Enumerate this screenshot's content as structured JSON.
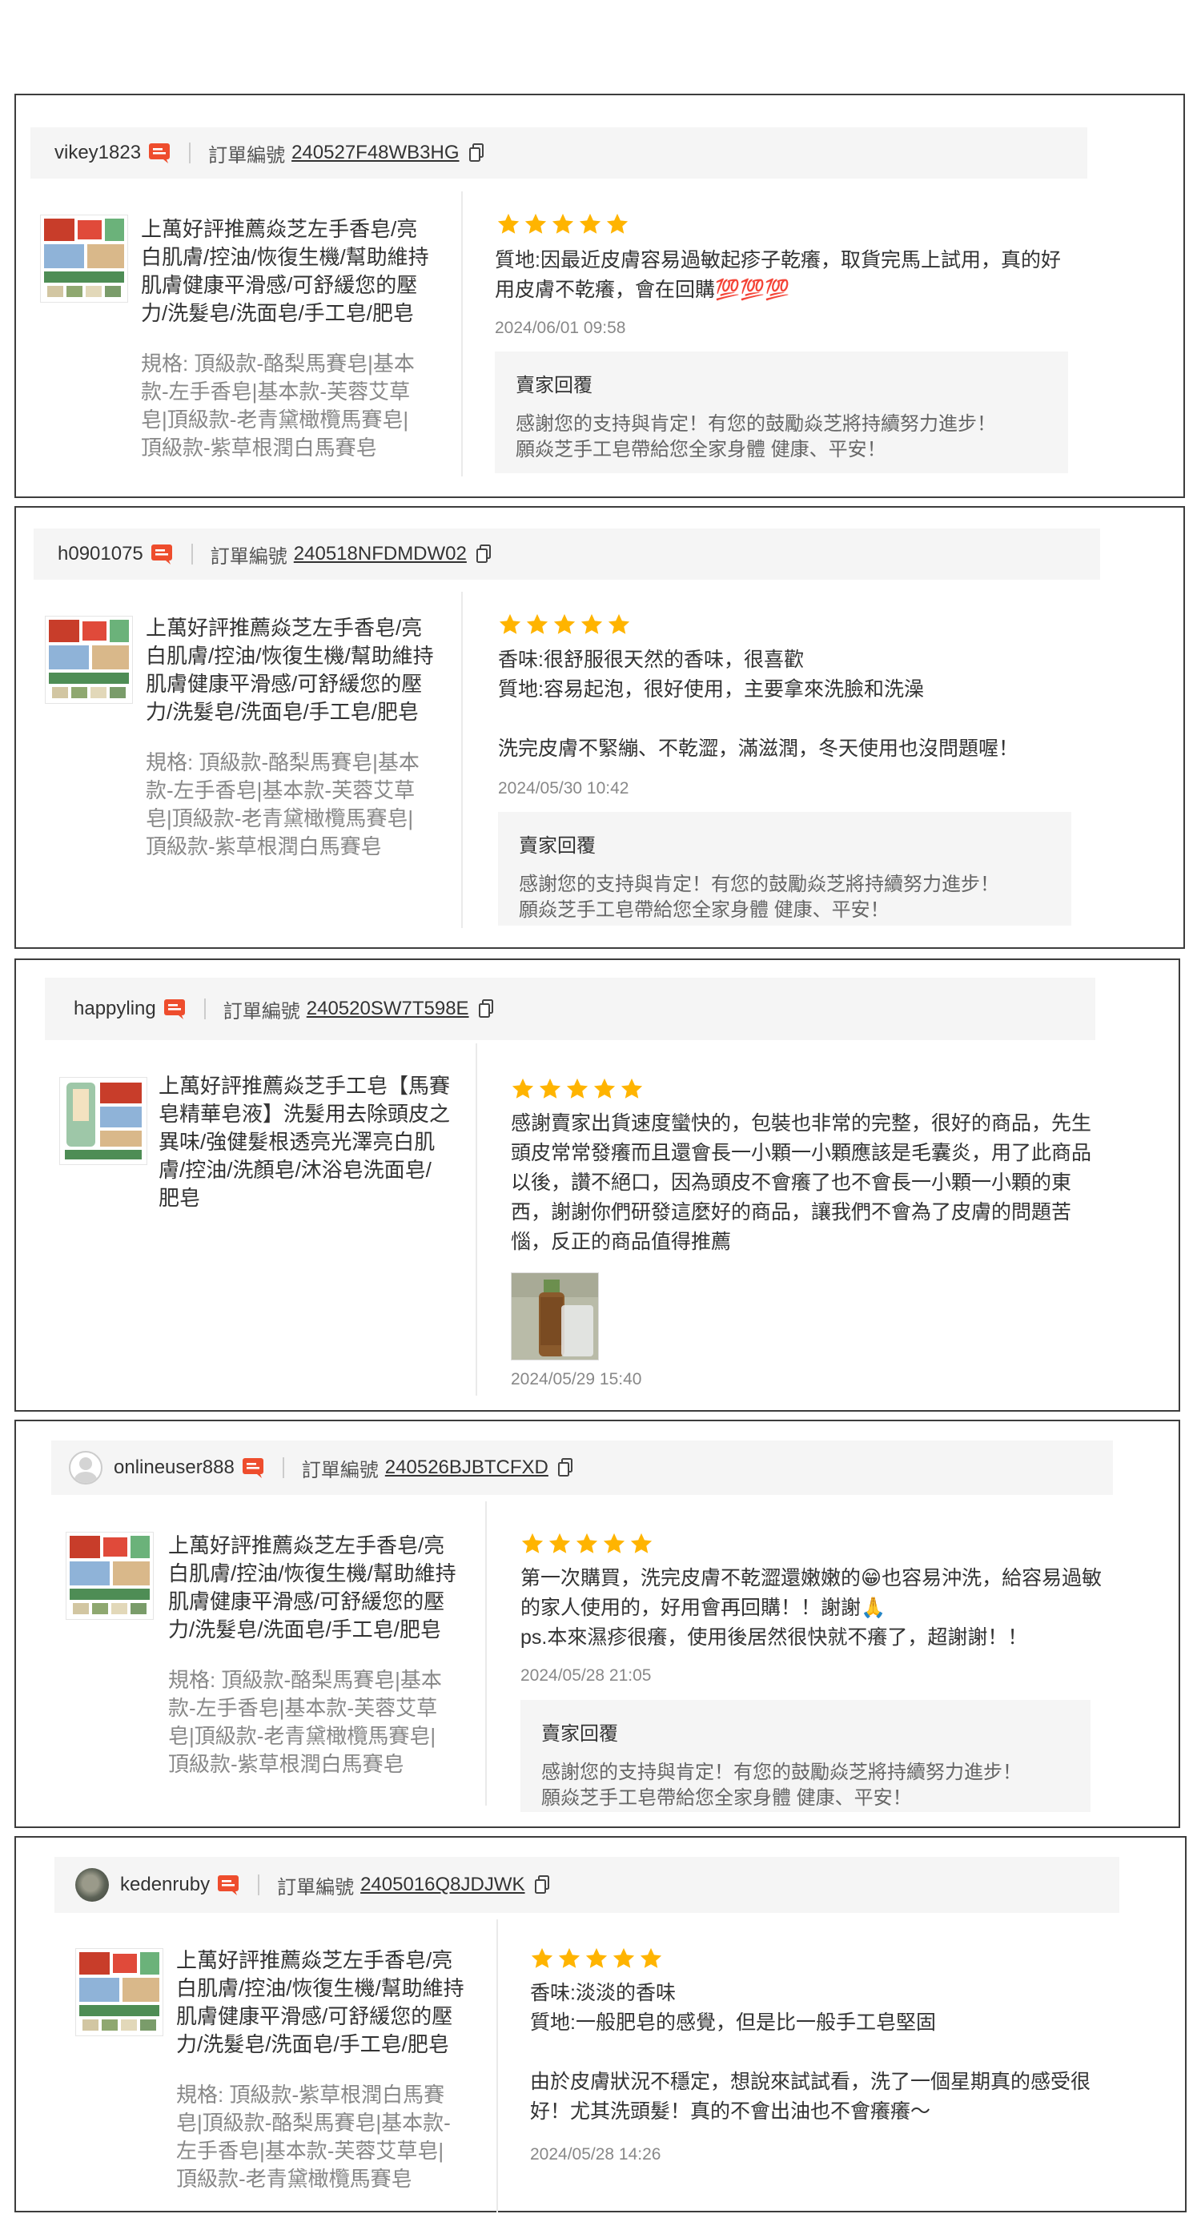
{
  "colors": {
    "star": "#ffb400",
    "chat_badge": "#ee4d2d",
    "border": "#3d3d3d",
    "panel": "#f5f5f5"
  },
  "reviews": [
    {
      "username": "vikey1823",
      "order_label": "訂單編號",
      "order_no": "240527F48WB3HG",
      "product_title": "上萬好評推薦焱芝左手香皂/亮白肌膚/控油/恢復生機/幫助維持肌膚健康平滑感/可舒緩您的壓力/洗髮皂/洗面皂/手工皂/肥皂",
      "product_spec": "規格: 頂級款-酪梨馬賽皂|基本款-左手香皂|基本款-芙蓉艾草皂|頂級款-老青黛橄欖馬賽皂|頂級款-紫草根潤白馬賽皂",
      "rating": 5,
      "text": "質地:因最近皮膚容易過敏起疹子乾癢，取貨完馬上試用，真的好用皮膚不乾癢，會在回購💯💯💯",
      "date": "2024/06/01 09:58",
      "reply_title": "賣家回覆",
      "reply_text": "感謝您的支持與肯定！有您的鼓勵焱芝將持續努力進步！\n願焱芝手工皂帶給您全家身體 健康、平安！"
    },
    {
      "username": "h0901075",
      "order_label": "訂單編號",
      "order_no": "240518NFDMDW02",
      "product_title": "上萬好評推薦焱芝左手香皂/亮白肌膚/控油/恢復生機/幫助維持肌膚健康平滑感/可舒緩您的壓力/洗髮皂/洗面皂/手工皂/肥皂",
      "product_spec": "規格: 頂級款-酪梨馬賽皂|基本款-左手香皂|基本款-芙蓉艾草皂|頂級款-老青黛橄欖馬賽皂|頂級款-紫草根潤白馬賽皂",
      "rating": 5,
      "text": "香味:很舒服很天然的香味，很喜歡\n質地:容易起泡，很好使用，主要拿來洗臉和洗澡\n\n洗完皮膚不緊繃、不乾澀，滿滋潤，冬天使用也沒問題喔！",
      "date": "2024/05/30 10:42",
      "reply_title": "賣家回覆",
      "reply_text": "感謝您的支持與肯定！有您的鼓勵焱芝將持續努力進步！\n願焱芝手工皂帶給您全家身體 健康、平安！"
    },
    {
      "username": "happyling",
      "order_label": "訂單編號",
      "order_no": "240520SW7T598E",
      "product_title": "上萬好評推薦焱芝手工皂【馬賽皂精華皂液】洗髮用去除頭皮之異味/強健髮根透亮光澤亮白肌膚/控油/洗顏皂/沐浴皂洗面皂/肥皂",
      "product_spec": "",
      "rating": 5,
      "text": "感謝賣家出貨速度蠻快的，包裝也非常的完整，很好的商品，先生頭皮常常發癢而且還會長一小顆一小顆應該是毛囊炎，用了此商品以後，讚不絕口，因為頭皮不會癢了也不會長一小顆一小顆的東西，謝謝你們研發這麼好的商品，讓我們不會為了皮膚的問題苦惱，反正的商品值得推薦",
      "date": "2024/05/29 15:40",
      "reply_title": "",
      "reply_text": ""
    },
    {
      "username": "onlineuser888",
      "order_label": "訂單編號",
      "order_no": "240526BJBTCFXD",
      "product_title": "上萬好評推薦焱芝左手香皂/亮白肌膚/控油/恢復生機/幫助維持肌膚健康平滑感/可舒緩您的壓力/洗髮皂/洗面皂/手工皂/肥皂",
      "product_spec": "規格: 頂級款-酪梨馬賽皂|基本款-左手香皂|基本款-芙蓉艾草皂|頂級款-老青黛橄欖馬賽皂|頂級款-紫草根潤白馬賽皂",
      "rating": 5,
      "text": "第一次購買，洗完皮膚不乾澀還嫩嫩的😁也容易沖洗，給容易過敏的家人使用的，好用會再回購！！謝謝🙏\nps.本來濕疹很癢，使用後居然很快就不癢了，超謝謝！！",
      "date": "2024/05/28 21:05",
      "reply_title": "賣家回覆",
      "reply_text": "感謝您的支持與肯定！有您的鼓勵焱芝將持續努力進步！\n願焱芝手工皂帶給您全家身體 健康、平安！"
    },
    {
      "username": "kedenruby",
      "order_label": "訂單編號",
      "order_no": "2405016Q8JDJWK",
      "product_title": "上萬好評推薦焱芝左手香皂/亮白肌膚/控油/恢復生機/幫助維持肌膚健康平滑感/可舒緩您的壓力/洗髮皂/洗面皂/手工皂/肥皂",
      "product_spec": "規格: 頂級款-紫草根潤白馬賽皂|頂級款-酪梨馬賽皂|基本款-左手香皂|基本款-芙蓉艾草皂|頂級款-老青黛橄欖馬賽皂",
      "rating": 5,
      "text": "香味:淡淡的香味\n質地:一般肥皂的感覺，但是比一般手工皂堅固\n\n由於皮膚狀況不穩定，想說來試試看，洗了一個星期真的感受很好！尤其洗頭髮！真的不會出油也不會癢癢～",
      "date": "2024/05/28 14:26",
      "reply_title": "",
      "reply_text": ""
    }
  ]
}
